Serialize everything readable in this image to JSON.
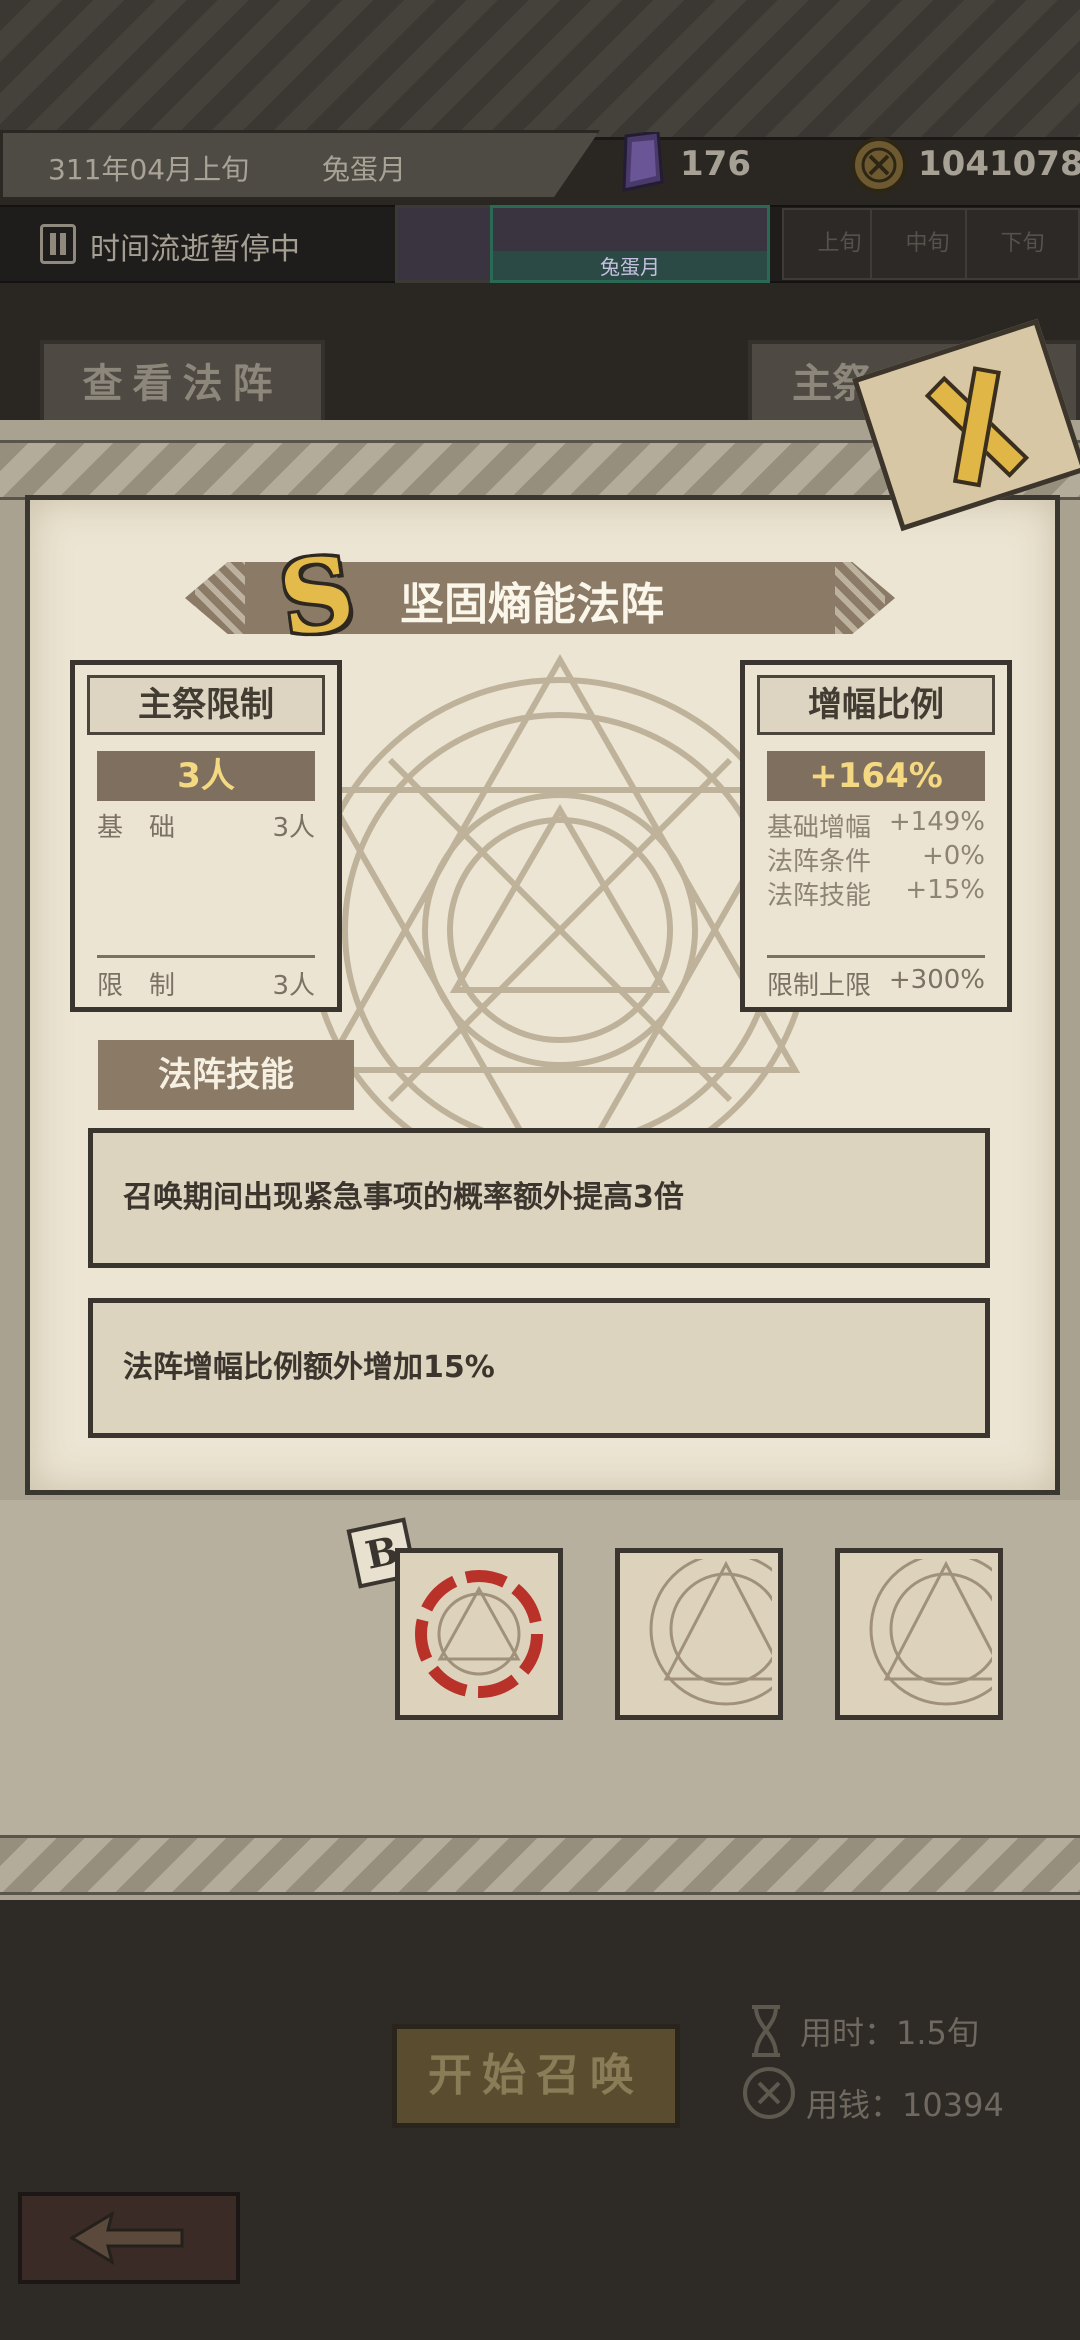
{
  "top_bar": {
    "date": "311年04月上旬",
    "month_name": "兔蛋月",
    "gems": "176",
    "coins": "1041078"
  },
  "time_bar": {
    "status": "时间流逝暂停中",
    "portrait_label": "兔蛋月",
    "slots": [
      "上旬",
      "中旬",
      "下旬"
    ]
  },
  "buttons": {
    "view_array": "查看法阵",
    "main_sacrifice": "主祭"
  },
  "array": {
    "rank": "S",
    "title": "坚固熵能法阵"
  },
  "sacrifice_limit": {
    "header": "主祭限制",
    "value": "3人",
    "rows": [
      {
        "label": "基　础",
        "value": "3人"
      }
    ],
    "footer": {
      "label": "限　制",
      "value": "3人"
    }
  },
  "amplify": {
    "header": "增幅比例",
    "value": "+164%",
    "rows": [
      {
        "label": "基础增幅",
        "value": "+149%"
      },
      {
        "label": "法阵条件",
        "value": "+0%"
      },
      {
        "label": "法阵技能",
        "value": "+15%"
      }
    ],
    "footer": {
      "label": "限制上限",
      "value": "+300%"
    }
  },
  "skills": {
    "tab": "法阵技能",
    "items": [
      "召唤期间出现紧急事项的概率额外提高3倍",
      "法阵增幅比例额外增加15%"
    ]
  },
  "array_slots": {
    "badge": "B"
  },
  "summon": {
    "button": "开始召唤",
    "time_cost": "用时：1.5旬",
    "money_cost": "用钱：10394"
  },
  "colors": {
    "parchment": "#ece5d3",
    "banner": "#8a7a66",
    "highlight_gold": "#f4d982",
    "rank_gold": "#e4bb4a",
    "selected_ring": "#b8322a"
  },
  "icons": [
    "pause-icon",
    "gem-icon",
    "coin-icon",
    "close-icon",
    "hourglass-icon",
    "back-arrow-icon"
  ]
}
